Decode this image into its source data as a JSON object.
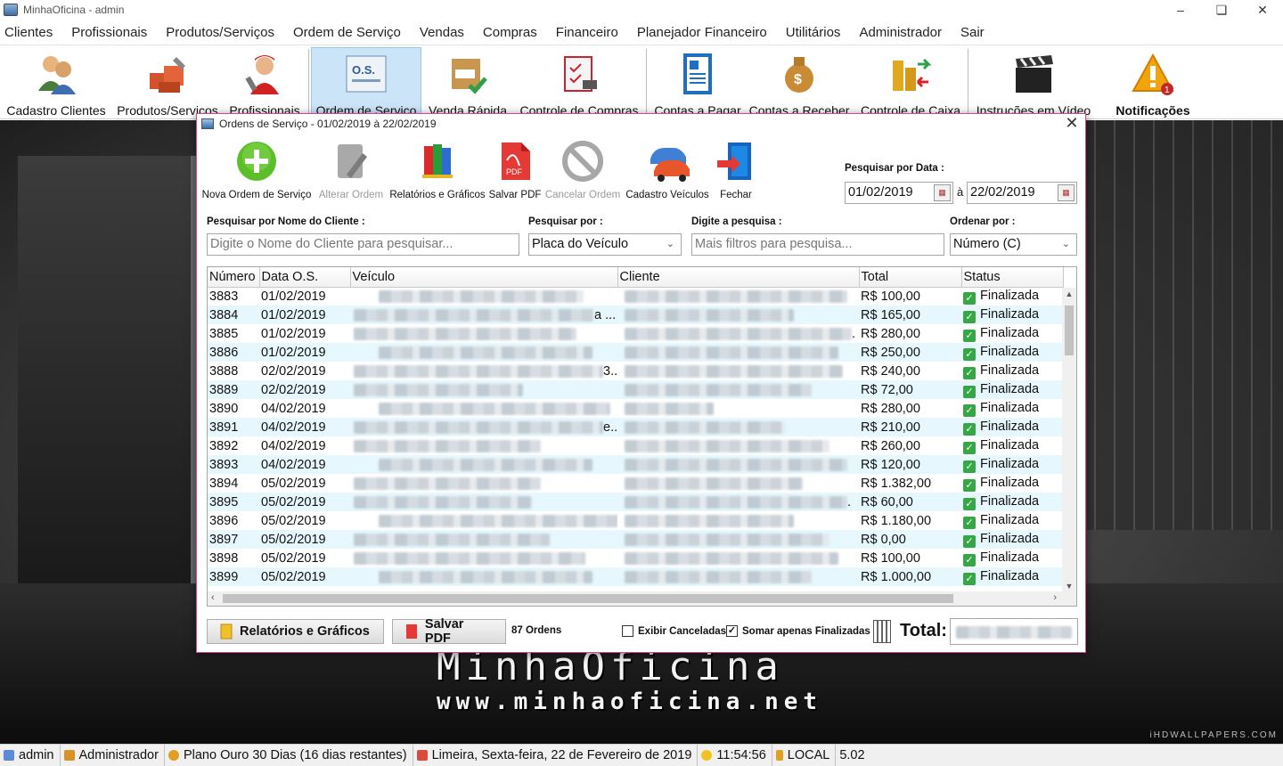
{
  "window": {
    "title": "MinhaOficina - admin"
  },
  "menu": [
    "Clientes",
    "Profissionais",
    "Produtos/Serviços",
    "Ordem de Serviço",
    "Vendas",
    "Compras",
    "Financeiro",
    "Planejador Financeiro",
    "Utilitários",
    "Administrador",
    "Sair"
  ],
  "toolbar": {
    "buttons": [
      {
        "label": "Cadastro Clientes",
        "icon": "users-icon"
      },
      {
        "label": "Produtos/Servicos",
        "icon": "boxes-tools-icon"
      },
      {
        "label": "Profissionais",
        "icon": "mechanic-icon"
      },
      {
        "label": "Ordem de Serviço",
        "icon": "service-order-icon",
        "active": true
      },
      {
        "label": "Venda Rápida",
        "icon": "quick-sale-icon"
      },
      {
        "label": "Controle de Compras",
        "icon": "purchase-clipboard-icon"
      },
      {
        "label": "Contas a Pagar",
        "icon": "bill-document-icon"
      },
      {
        "label": "Contas a Receber",
        "icon": "money-bag-icon"
      },
      {
        "label": "Controle de Caixa",
        "icon": "cash-flow-icon"
      },
      {
        "label": "Instruções em Vídeo",
        "icon": "clapperboard-icon"
      },
      {
        "label": "Notificações",
        "icon": "warning-icon",
        "badge": "1"
      }
    ]
  },
  "background": {
    "brand": "MinhaOficina",
    "url": "www.minhaoficina.net",
    "watermark": "iHDWALLPAPERS.COM"
  },
  "dialog": {
    "title": "Ordens de Serviço - 01/02/2019 à 22/02/2019",
    "actions": [
      {
        "label": "Nova Ordem de Serviço",
        "icon": "add-green-icon",
        "enabled": true
      },
      {
        "label": "Alterar Ordem",
        "icon": "edit-document-icon",
        "enabled": false
      },
      {
        "label": "Relatórios e Gráficos",
        "icon": "reports-books-icon",
        "enabled": true
      },
      {
        "label": "Salvar PDF",
        "icon": "pdf-icon",
        "enabled": true
      },
      {
        "label": "Cancelar Ordem",
        "icon": "cancel-icon",
        "enabled": false
      },
      {
        "label": "Cadastro Veículos",
        "icon": "cars-icon",
        "enabled": true
      },
      {
        "label": "Fechar",
        "icon": "exit-door-icon",
        "enabled": true
      }
    ],
    "date_search": {
      "label": "Pesquisar por Data :",
      "from": "01/02/2019",
      "separator": "à",
      "to": "22/02/2019"
    },
    "client_search": {
      "label": "Pesquisar por Nome do Cliente :",
      "placeholder": "Digite o Nome do Cliente para pesquisar..."
    },
    "search_by": {
      "label": "Pesquisar por :",
      "value": "Placa do Veículo"
    },
    "query": {
      "label": "Digite a pesquisa :",
      "placeholder": "Mais filtros para pesquisa..."
    },
    "order_by": {
      "label": "Ordenar por :",
      "value": "Número (C)"
    },
    "table": {
      "columns": [
        "Número",
        "Data O.S.",
        "Veículo",
        "Cliente",
        "Total",
        "Status"
      ],
      "rows": [
        {
          "numero": "3883",
          "data": "01/02/2019",
          "veiculo_suffix": "",
          "cliente_suffix": "",
          "total": "R$ 100,00",
          "status": "Finalizada"
        },
        {
          "numero": "3884",
          "data": "01/02/2019",
          "veiculo_suffix": "a ...",
          "cliente_suffix": "",
          "total": "R$ 165,00",
          "status": "Finalizada"
        },
        {
          "numero": "3885",
          "data": "01/02/2019",
          "veiculo_suffix": "",
          "cliente_suffix": ".",
          "total": "R$ 280,00",
          "status": "Finalizada"
        },
        {
          "numero": "3886",
          "data": "01/02/2019",
          "veiculo_suffix": "",
          "cliente_suffix": "",
          "total": "R$ 250,00",
          "status": "Finalizada"
        },
        {
          "numero": "3888",
          "data": "02/02/2019",
          "veiculo_suffix": "3...",
          "cliente_suffix": "",
          "total": "R$ 240,00",
          "status": "Finalizada"
        },
        {
          "numero": "3889",
          "data": "02/02/2019",
          "veiculo_suffix": "",
          "cliente_suffix": "",
          "total": "R$ 72,00",
          "status": "Finalizada"
        },
        {
          "numero": "3890",
          "data": "04/02/2019",
          "veiculo_suffix": "",
          "cliente_suffix": "",
          "total": "R$ 280,00",
          "status": "Finalizada"
        },
        {
          "numero": "3891",
          "data": "04/02/2019",
          "veiculo_suffix": "e...",
          "cliente_suffix": "",
          "total": "R$ 210,00",
          "status": "Finalizada"
        },
        {
          "numero": "3892",
          "data": "04/02/2019",
          "veiculo_suffix": "",
          "cliente_suffix": "",
          "total": "R$ 260,00",
          "status": "Finalizada"
        },
        {
          "numero": "3893",
          "data": "04/02/2019",
          "veiculo_suffix": "",
          "cliente_suffix": "",
          "total": "R$ 120,00",
          "status": "Finalizada"
        },
        {
          "numero": "3894",
          "data": "05/02/2019",
          "veiculo_suffix": "",
          "cliente_suffix": "",
          "total": "R$ 1.382,00",
          "status": "Finalizada"
        },
        {
          "numero": "3895",
          "data": "05/02/2019",
          "veiculo_suffix": "",
          "cliente_suffix": ".",
          "total": "R$ 60,00",
          "status": "Finalizada"
        },
        {
          "numero": "3896",
          "data": "05/02/2019",
          "veiculo_suffix": "3r..",
          "cliente_suffix": "",
          "total": "R$ 1.180,00",
          "status": "Finalizada"
        },
        {
          "numero": "3897",
          "data": "05/02/2019",
          "veiculo_suffix": "",
          "cliente_suffix": "",
          "total": "R$ 0,00",
          "status": "Finalizada"
        },
        {
          "numero": "3898",
          "data": "05/02/2019",
          "veiculo_suffix": "",
          "cliente_suffix": "",
          "total": "R$ 100,00",
          "status": "Finalizada"
        },
        {
          "numero": "3899",
          "data": "05/02/2019",
          "veiculo_suffix": "",
          "cliente_suffix": "",
          "total": "R$ 1.000,00",
          "status": "Finalizada"
        }
      ]
    },
    "footer": {
      "reports_button": "Relatórios e Gráficos",
      "pdf_button": "Salvar PDF",
      "count": "87 Ordens",
      "show_cancelled": {
        "label": "Exibir Canceladas",
        "checked": false
      },
      "sum_finalized": {
        "label": "Somar apenas Finalizadas",
        "checked": true
      },
      "total_label": "Total:"
    }
  },
  "statusbar": {
    "user": "admin",
    "role": "Administrador",
    "plan": "Plano Ouro 30 Dias (16 dias restantes)",
    "location_date": "Limeira, Sexta-feira, 22 de Fevereiro de 2019",
    "time": "11:54:56",
    "db": "LOCAL",
    "version": "5.02"
  },
  "colors": {
    "accent": "#d04a9a",
    "active_tool": "#cce4f7",
    "row_alt": "#e6f7fd",
    "status_ok": "#35a845"
  }
}
